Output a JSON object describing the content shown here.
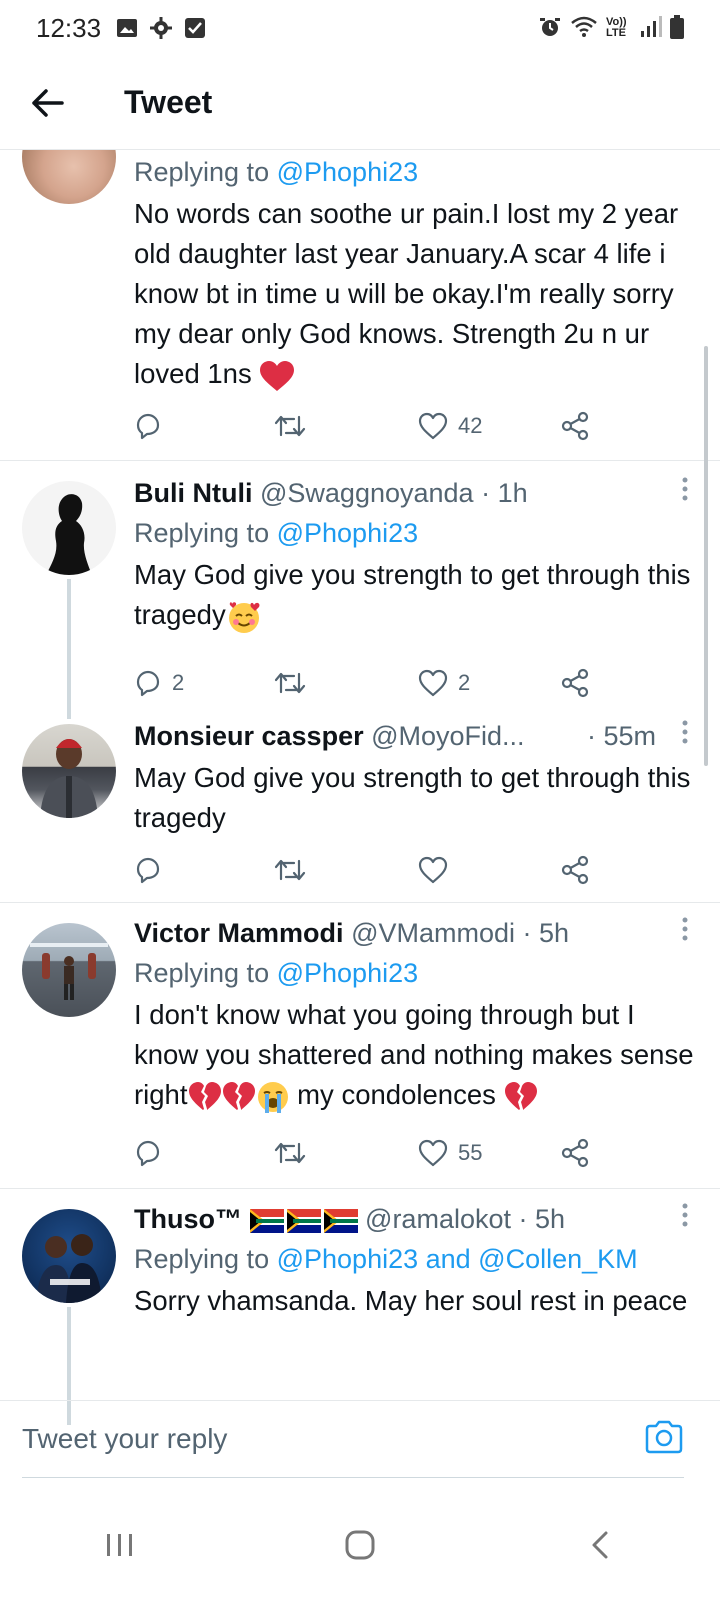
{
  "status_bar": {
    "time": "12:33",
    "network": "Vo)) LTE"
  },
  "app_bar": {
    "title": "Tweet"
  },
  "tweets": [
    {
      "replying_prefix": "Replying to",
      "replying_to": "@Phophi23",
      "body": "No words can soothe ur pain.I lost my 2 year old daughter last year January.A scar 4 life i know bt in time u will be okay.I'm really sorry my dear only God knows. Strength 2u n ur loved 1ns",
      "reply_count": "",
      "like_count": "42"
    },
    {
      "name": "Buli Ntuli",
      "handle": "@Swaggnoyanda",
      "time": "· 1h",
      "replying_prefix": "Replying to",
      "replying_to": "@Phophi23",
      "body": "May God give you strength to get through this tragedy",
      "reply_count": "2",
      "like_count": "2"
    },
    {
      "name": "Monsieur cassper",
      "handle": "@MoyoFid...",
      "time": "· 55m",
      "body": "May God give you strength to get through this tragedy",
      "reply_count": "",
      "like_count": ""
    },
    {
      "name": "Victor Mammodi",
      "handle": "@VMammodi",
      "time": "· 5h",
      "replying_prefix": "Replying to",
      "replying_to": "@Phophi23",
      "body_a": "I don't know what you going through but I know you shattered and nothing makes sense right",
      "body_b": " my condolences ",
      "reply_count": "",
      "like_count": "55"
    },
    {
      "name": "Thuso™",
      "handle": "@ramalokot",
      "time": "· 5h",
      "replying_prefix": "Replying to",
      "replying_to": "@Phophi23 and @Collen_KM",
      "body": "Sorry vhamsanda. May her soul rest in peace"
    }
  ],
  "composer": {
    "placeholder": "Tweet your reply"
  },
  "colors": {
    "accent": "#1d9bf0",
    "text": "#0f1419",
    "secondary": "#536471",
    "heart": "#e0245e"
  }
}
